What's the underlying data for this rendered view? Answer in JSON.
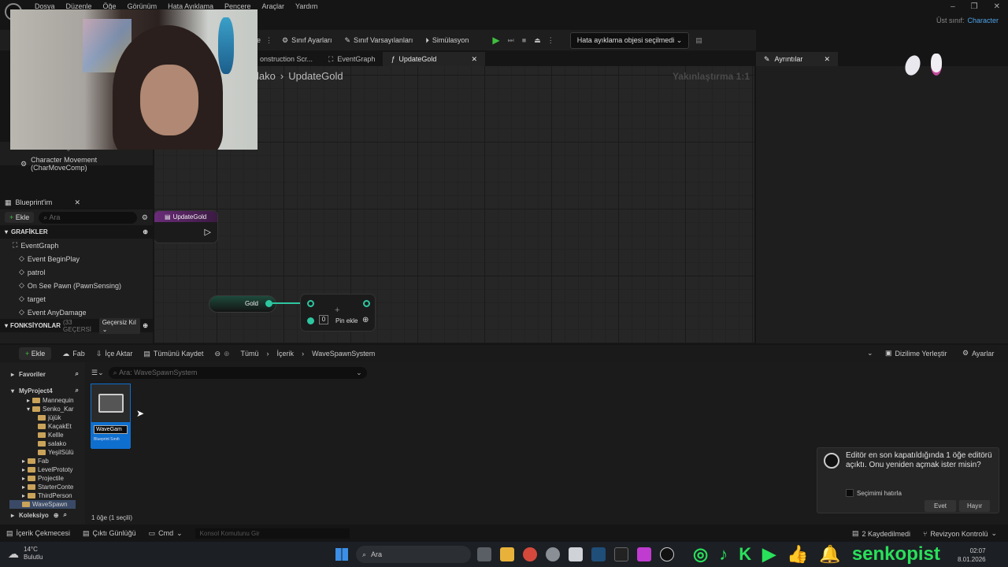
{
  "menu": [
    "Dosya",
    "Düzenle",
    "Öğe",
    "Görünüm",
    "Hata Ayıklama",
    "Pencere",
    "Araçlar",
    "Yardım"
  ],
  "parent_class": {
    "label": "Üst sınıf:",
    "value": "Character"
  },
  "toolbar": {
    "class_settings": "Sınıf Ayarları",
    "class_defaults": "Sınıf Varsayılanları",
    "simulation": "Simülasyon",
    "debug_object": "Hata ayıklama objesi seçilmedi"
  },
  "tabs": [
    "onstruction Scr...",
    "EventGraph",
    "UpdateGold"
  ],
  "details_tab": "Ayrıntılar",
  "graph": {
    "crumb_prefix": "lako",
    "crumb_sep": "›",
    "crumb_current": "UpdateGold",
    "zoom": "Yakınlaştırma 1:1",
    "entry_node": "UpdateGold",
    "gold_node": "Gold",
    "pin_value": "0",
    "pin_add": "Pin ekle"
  },
  "components": {
    "item": "Character Movement (CharMoveComp)",
    "partial": "PawnSensing"
  },
  "my_blueprint": {
    "title": "Blueprint'im",
    "add": "Ekle",
    "search_placeholder": "Ara",
    "graphs_header": "GRAFİKLER",
    "functions_header": "FONKSİYONLAR",
    "functions_count": "(33 GEÇERSİ",
    "functions_filter": "Geçersiz Kıl",
    "items": [
      "EventGraph",
      "Event BeginPlay",
      "patrol",
      "On See Pawn (PawnSensing)",
      "target",
      "Event AnyDamage"
    ]
  },
  "content_bar": {
    "add": "Ekle",
    "fab": "Fab",
    "import": "İçe Aktar",
    "save_all": "Tümünü Kaydet",
    "path": [
      "Tümü",
      "İçerik",
      "WaveSpawnSystem"
    ],
    "dock": "Dizilime Yerleştir",
    "settings": "Ayarlar"
  },
  "content": {
    "favorites": "Favoriler",
    "project": "MyProject4",
    "collections": "Koleksiyo",
    "tree": [
      "Mannequin",
      "Senko_Kar",
      "jüjük",
      "KaçakEt",
      "Kellle",
      "salako",
      "YeşilSülü",
      "Fab",
      "LevelPrototy",
      "Projectile",
      "StarterConte",
      "ThirdPerson",
      "WaveSpawn"
    ],
    "search_placeholder": "Ara: WaveSpawnSystem",
    "asset_name": "WaveGam",
    "asset_type": "Blueprint Sınıfı",
    "count": "1 öğe (1 seçili)"
  },
  "status": {
    "drawer": "İçerik Çekmecesi",
    "log": "Çıktı Günlüğü",
    "cmd": "Cmd",
    "console_placeholder": "Konsol Komutunu Gir",
    "saved": "2 Kaydedilmedi",
    "revision": "Revizyon Kontrolü"
  },
  "notification": {
    "message": "Editör en son kapatıldığında 1 öğe editörü açıktı. Onu yeniden açmak ister misin?",
    "remember": "Seçimimi hatırla",
    "yes": "Evet",
    "no": "Hayır"
  },
  "taskbar": {
    "temp": "14°C",
    "weather": "Bulutlu",
    "search": "Ara",
    "time": "02:07",
    "date": "8.01.2026",
    "brand": "senkopist"
  },
  "colors": {
    "accent": "#0e6fcf",
    "exec_green": "#3fbf3f",
    "pin_teal": "#2ec6a0",
    "social_green": "#29e05a"
  }
}
